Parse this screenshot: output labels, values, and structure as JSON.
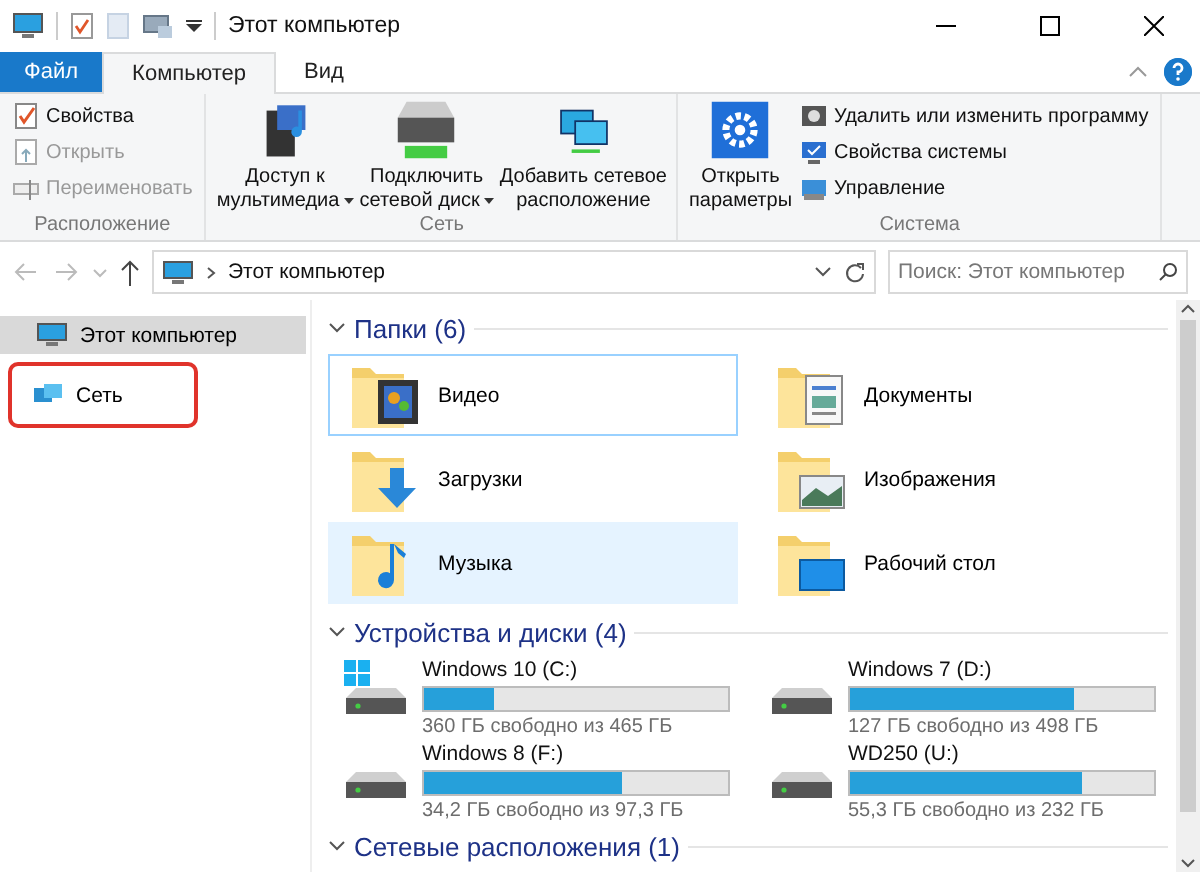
{
  "window": {
    "title": "Этот компьютер"
  },
  "tabs": [
    {
      "label": "Файл",
      "kind": "file",
      "selected": false
    },
    {
      "label": "Компьютер",
      "kind": "tab",
      "selected": true
    },
    {
      "label": "Вид",
      "kind": "tab",
      "selected": false
    }
  ],
  "ribbon": {
    "groups": [
      {
        "label": "Расположение",
        "items": [
          {
            "label": "Свойства",
            "kind": "small",
            "disabled": false
          },
          {
            "label": "Открыть",
            "kind": "small",
            "disabled": true
          },
          {
            "label": "Переименовать",
            "kind": "small",
            "disabled": true
          }
        ]
      },
      {
        "label": "Сеть",
        "items": [
          {
            "label": "Доступ к\nмультимедиа",
            "kind": "large",
            "dropdown": true
          },
          {
            "label": "Подключить\nсетевой диск",
            "kind": "large",
            "dropdown": true
          },
          {
            "label": "Добавить сетевое\nрасположение",
            "kind": "large",
            "dropdown": false
          }
        ]
      },
      {
        "label": "Система",
        "items": [
          {
            "label": "Открыть\nпараметры",
            "kind": "large",
            "dropdown": false
          },
          {
            "label": "Удалить или изменить программу",
            "kind": "small",
            "disabled": false
          },
          {
            "label": "Свойства системы",
            "kind": "small",
            "disabled": false
          },
          {
            "label": "Управление",
            "kind": "small",
            "disabled": false
          }
        ]
      }
    ]
  },
  "address": {
    "path": "Этот компьютер",
    "search_placeholder": "Поиск: Этот компьютер"
  },
  "sidebar": {
    "items": [
      {
        "label": "Этот компьютер",
        "selected": true,
        "highlighted": false
      },
      {
        "label": "Сеть",
        "selected": false,
        "highlighted": true
      }
    ]
  },
  "sections": [
    {
      "title": "Папки (6)",
      "kind": "folders",
      "items": [
        {
          "name": "Видео",
          "selected": false,
          "focused": true
        },
        {
          "name": "Документы",
          "selected": false,
          "focused": false
        },
        {
          "name": "Загрузки",
          "selected": false,
          "focused": false
        },
        {
          "name": "Изображения",
          "selected": false,
          "focused": false
        },
        {
          "name": "Музыка",
          "selected": true,
          "focused": false
        },
        {
          "name": "Рабочий стол",
          "selected": false,
          "focused": false
        }
      ]
    },
    {
      "title": "Устройства и диски (4)",
      "kind": "drives",
      "items": [
        {
          "name": "Windows 10 (C:)",
          "system": true,
          "level": 0.23,
          "free": "360 ГБ свободно из 465 ГБ"
        },
        {
          "name": "Windows 7 (D:)",
          "system": false,
          "level": 0.74,
          "free": "127 ГБ свободно из 498 ГБ"
        },
        {
          "name": "Windows 8 (F:)",
          "system": false,
          "level": 0.65,
          "free": "34,2 ГБ свободно из 97,3 ГБ"
        },
        {
          "name": "WD250 (U:)",
          "system": false,
          "level": 0.76,
          "free": "55,3 ГБ свободно из 232 ГБ"
        }
      ]
    },
    {
      "title": "Сетевые расположения (1)",
      "kind": "network"
    }
  ]
}
